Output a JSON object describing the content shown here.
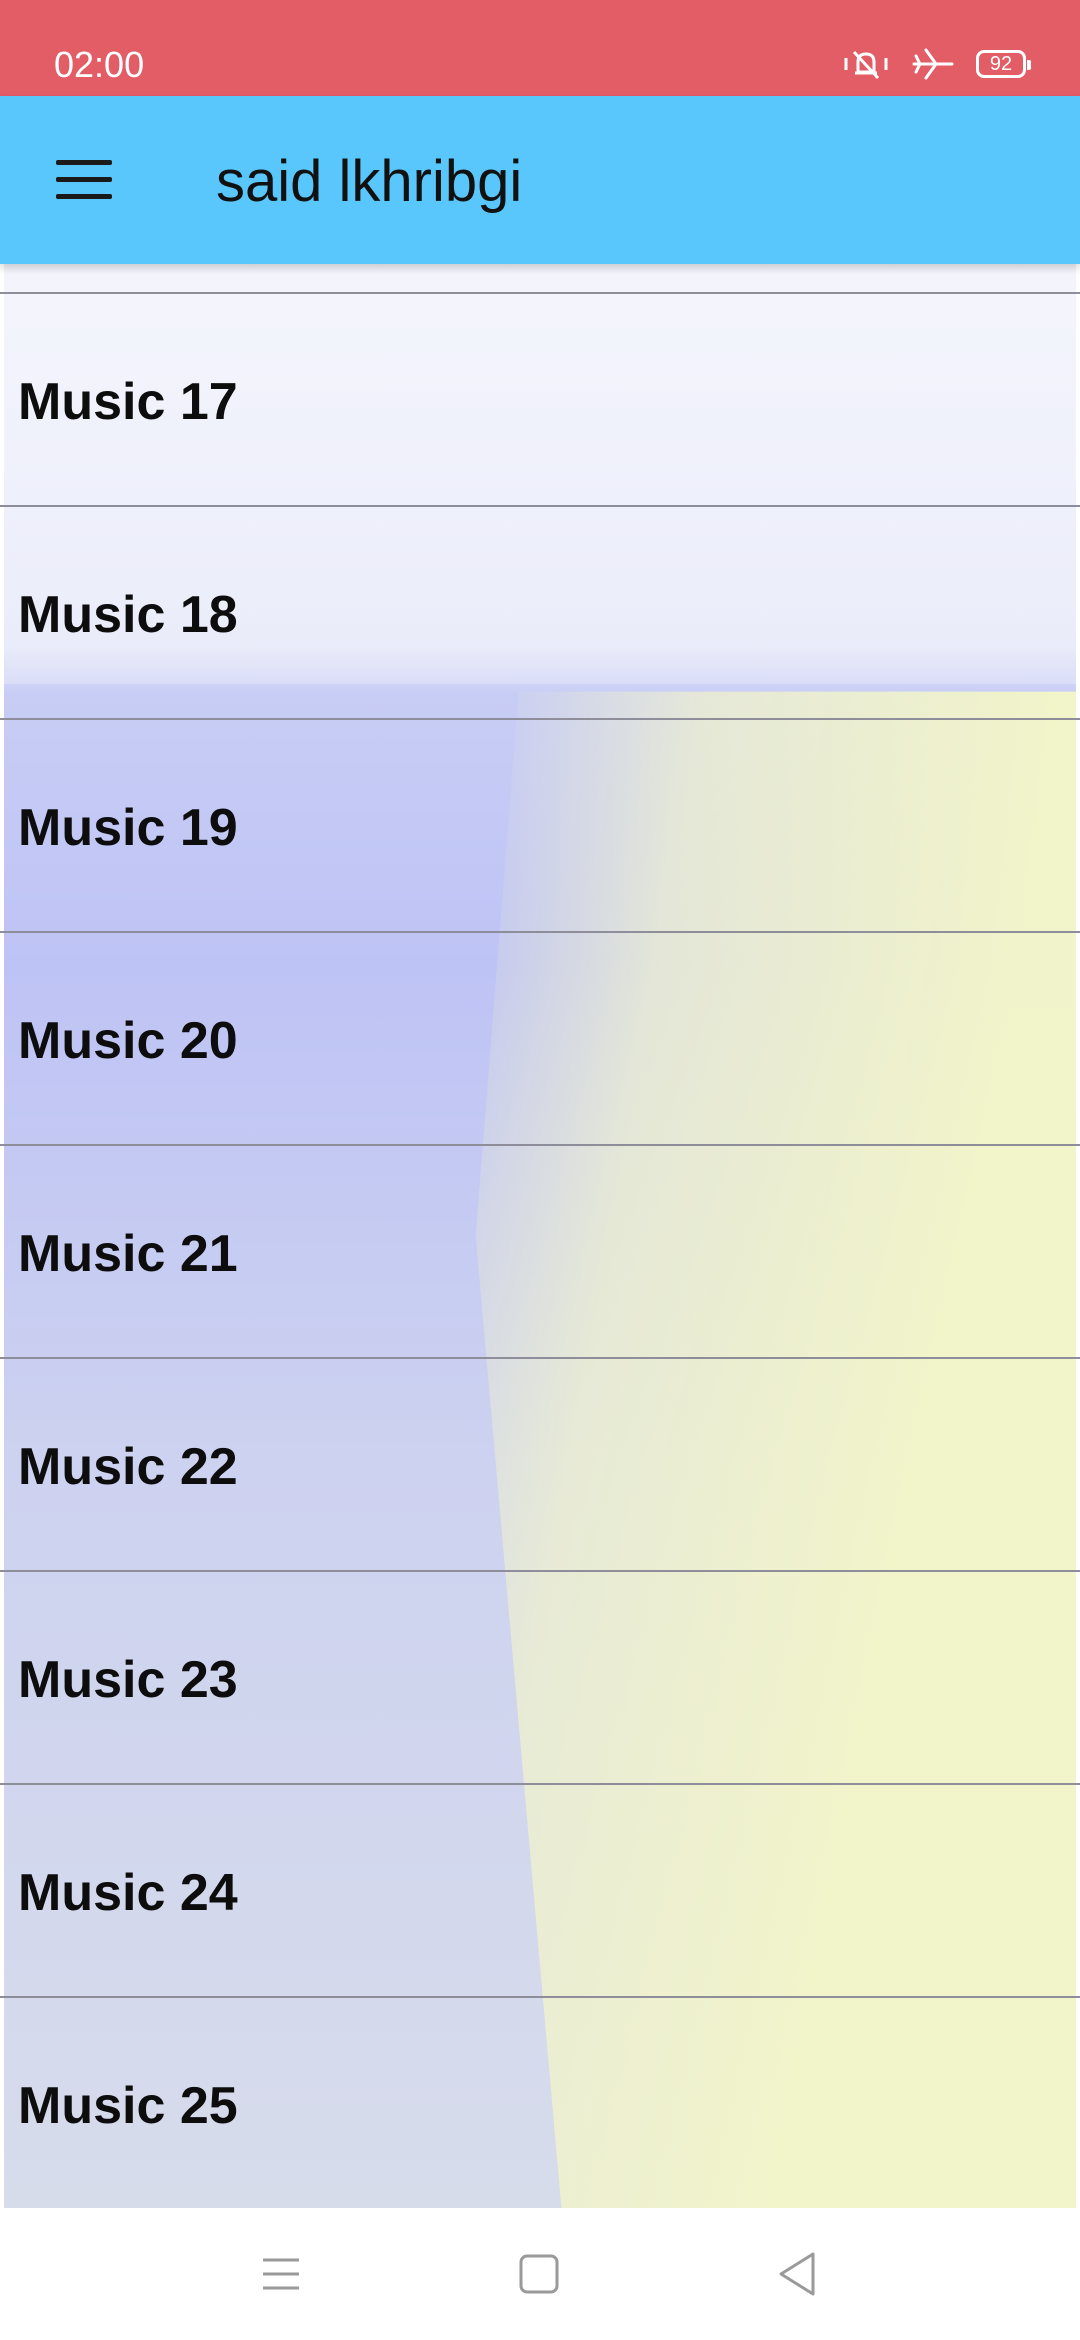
{
  "status_bar": {
    "time": "02:00",
    "battery_level": "92",
    "icons": [
      "mute-vibrate-icon",
      "airplane-mode-icon",
      "battery-icon"
    ],
    "background_color": "#e35d67"
  },
  "app_bar": {
    "title": "said lkhribgi",
    "menu_icon": "hamburger-menu-icon",
    "background_color": "#59c7fc"
  },
  "tracks": [
    {
      "label": "Music 17"
    },
    {
      "label": "Music 18"
    },
    {
      "label": "Music 19"
    },
    {
      "label": "Music 20"
    },
    {
      "label": "Music 21"
    },
    {
      "label": "Music 22"
    },
    {
      "label": "Music 23"
    },
    {
      "label": "Music 24"
    },
    {
      "label": "Music 25"
    }
  ],
  "nav_bar": {
    "buttons": [
      "recent-apps-icon",
      "home-icon",
      "back-icon"
    ]
  }
}
